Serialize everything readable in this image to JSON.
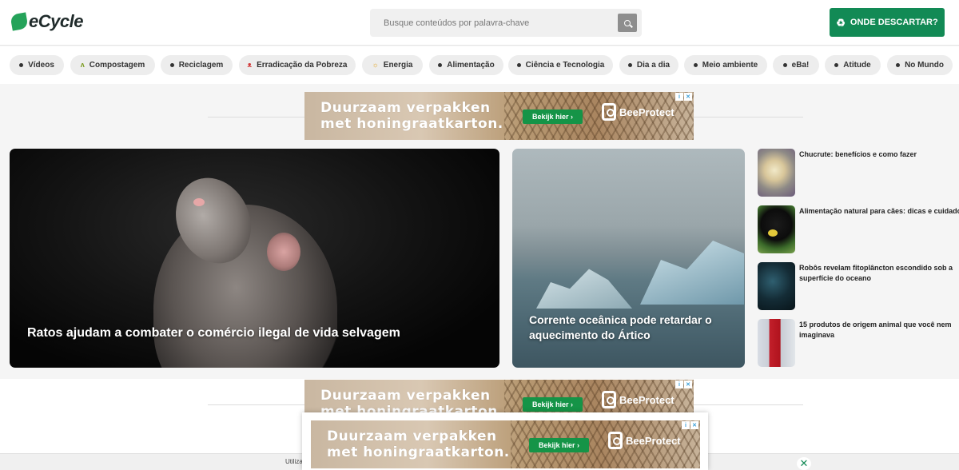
{
  "header": {
    "logo_text": "eCycle",
    "search_placeholder": "Busque conteúdos por palavra-chave",
    "cta_label": "ONDE DESCARTAR?"
  },
  "categories": [
    {
      "label": "Vídeos",
      "icon": "dot"
    },
    {
      "label": "Compostagem",
      "icon": "sprout-icon"
    },
    {
      "label": "Reciclagem",
      "icon": "dot"
    },
    {
      "label": "Erradicação da Pobreza",
      "icon": "people-icon"
    },
    {
      "label": "Energia",
      "icon": "sun-icon"
    },
    {
      "label": "Alimentação",
      "icon": "dot"
    },
    {
      "label": "Ciência e Tecnologia",
      "icon": "dot"
    },
    {
      "label": "Dia a dia",
      "icon": "dot"
    },
    {
      "label": "Meio ambiente",
      "icon": "dot"
    },
    {
      "label": "eBa!",
      "icon": "dot"
    },
    {
      "label": "Atitude",
      "icon": "dot"
    },
    {
      "label": "No Mundo",
      "icon": "dot"
    }
  ],
  "ad": {
    "line1": "Duurzaam verpakken",
    "line2": "met honingraatkarton.",
    "button": "Bekijk hier ›",
    "brand": "BeeProtect"
  },
  "featured": [
    {
      "title": "Ratos ajudam a combater o comércio ilegal de vida selvagem"
    },
    {
      "title": "Corrente oceânica pode retardar o aquecimento do Ártico"
    }
  ],
  "side_list": [
    {
      "title": "Chucrute: benefícios e como fazer"
    },
    {
      "title": "Alimentação natural para cães: dicas e cuidados"
    },
    {
      "title": "Robôs revelam fitoplâncton escondido sob a superfície do oceano"
    },
    {
      "title": "15 produtos de origem animal que você nem imaginava"
    }
  ],
  "cookie_text": "Utiliza",
  "colors": {
    "brand_green": "#128a55",
    "ad_button_green": "#159447"
  }
}
